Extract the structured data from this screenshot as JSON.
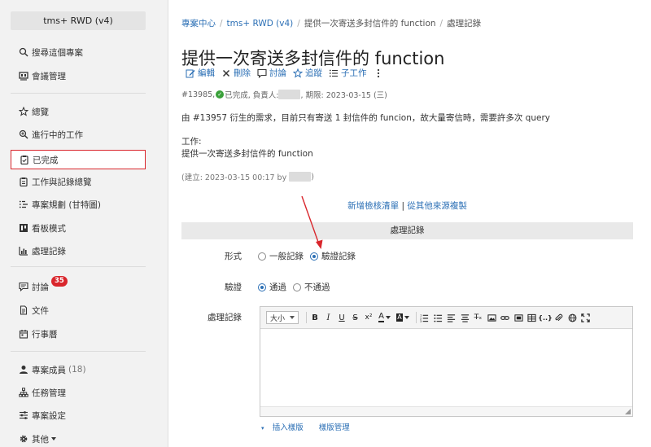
{
  "sidebar": {
    "project_title": "tms+ RWD (v4)",
    "items": [
      {
        "label": "搜尋這個專案"
      },
      {
        "label": "會議管理"
      },
      {
        "label": "總覽"
      },
      {
        "label": "進行中的工作"
      },
      {
        "label": "已完成"
      },
      {
        "label": "工作與記錄總覽"
      },
      {
        "label": "專案規劃 (甘特圖)"
      },
      {
        "label": "看板模式"
      },
      {
        "label": "處理記錄"
      },
      {
        "label": "討論",
        "badge": "35"
      },
      {
        "label": "文件"
      },
      {
        "label": "行事曆"
      },
      {
        "label": "專案成員",
        "count": "(18)"
      },
      {
        "label": "任務管理"
      },
      {
        "label": "專案設定"
      },
      {
        "label": "其他"
      }
    ]
  },
  "breadcrumb": {
    "items": [
      "專案中心",
      "tms+ RWD (v4)",
      "提供一次寄送多封信件的 function",
      "處理記錄"
    ],
    "separator": "/"
  },
  "issue": {
    "title": "提供一次寄送多封信件的 function",
    "actions": {
      "edit": "編輯",
      "delete": "刪除",
      "discuss": "討論",
      "track": "追蹤",
      "subtask": "子工作"
    },
    "meta_id": "#13985,",
    "meta_status": "已完成, 負責人:",
    "meta_due": ", 期限: 2023-03-15 (三)",
    "description": "由 #13957 衍生的需求，目前只有寄送 1 封信件的 funcion，故大量寄信時，需要許多次 query",
    "work_label": "工作:",
    "work_text": "提供一次寄送多封信件的 function",
    "created_prefix": "(建立: 2023-03-15 00:17 by",
    "created_suffix": ")"
  },
  "links": {
    "add_checklist": "新增檢核清單",
    "divider": "|",
    "copy_from": "從其他來源複製"
  },
  "record_form": {
    "section_title": "處理記錄",
    "type_label": "形式",
    "type_options": [
      "一般記錄",
      "驗證記錄"
    ],
    "type_selected": "驗證記錄",
    "verify_label": "驗證",
    "verify_options": [
      "通過",
      "不通過"
    ],
    "verify_selected": "通過",
    "content_label": "處理記錄",
    "font_size_label": "大小",
    "insert_template": "插入樣版",
    "manage_template": "樣版管理"
  },
  "colors": {
    "link": "#2b6fb5",
    "badge": "#d9262c",
    "highlight_border": "#d9262c",
    "success": "#3aa03a"
  }
}
